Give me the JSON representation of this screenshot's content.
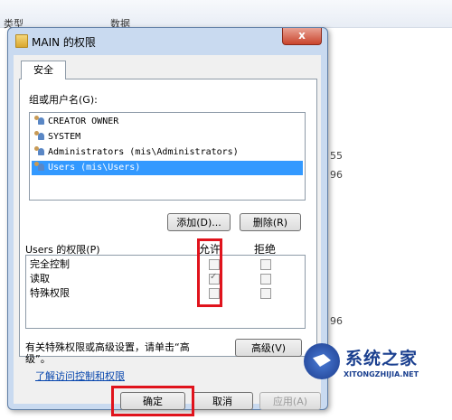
{
  "background": {
    "columns": [
      "类型",
      "数据"
    ],
    "side_values": [
      "55",
      "96",
      "96"
    ]
  },
  "window": {
    "title": "MAIN 的权限",
    "close_label": "x"
  },
  "tabs": [
    {
      "label": "安全"
    }
  ],
  "group_label": "组或用户名(G):",
  "users": [
    {
      "name": "CREATOR OWNER",
      "icon": "users-icon",
      "selected": false
    },
    {
      "name": "SYSTEM",
      "icon": "users-icon",
      "selected": false
    },
    {
      "name": "Administrators (mis\\Administrators)",
      "icon": "users-icon",
      "selected": false
    },
    {
      "name": "Users (mis\\Users)",
      "icon": "users-icon",
      "selected": true
    }
  ],
  "buttons": {
    "add": "添加(D)...",
    "remove": "删除(R)",
    "advanced": "高级(V)",
    "ok": "确定",
    "cancel": "取消",
    "apply": "应用(A)"
  },
  "permissions": {
    "header": "Users 的权限(P)",
    "allow_label": "允许",
    "deny_label": "拒绝",
    "items": [
      {
        "name": "完全控制",
        "allow": false,
        "deny": false
      },
      {
        "name": "读取",
        "allow": true,
        "deny": false
      },
      {
        "name": "特殊权限",
        "allow": false,
        "deny": false
      }
    ]
  },
  "advanced_note": "有关特殊权限或高级设置，请单击“高级”。",
  "advanced_note_line1": "有关特殊权限或高级设置，请单击“高",
  "advanced_note_line2": "级”。",
  "help_link": "了解访问控制和权限",
  "watermark": {
    "name": "系统之家",
    "url": "XITONGZHIJIA.NET"
  },
  "colors": {
    "highlight": "#e0131c",
    "selection": "#3399ff",
    "dialog_frame": "#c9daf0"
  }
}
